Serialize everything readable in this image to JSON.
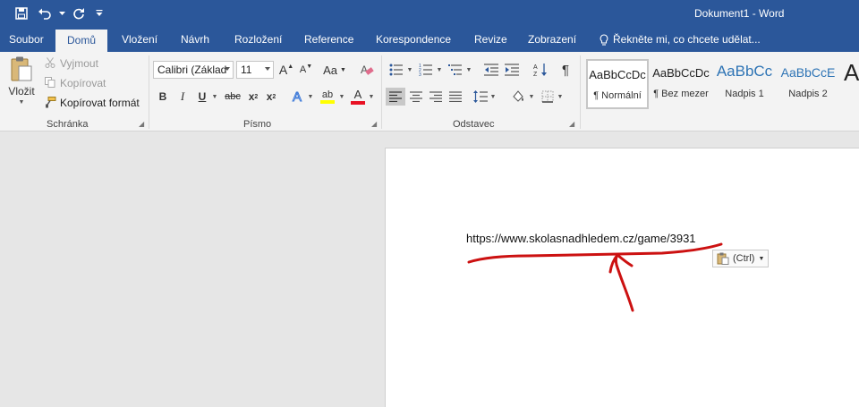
{
  "window": {
    "title": "Dokument1 - Word"
  },
  "quick_access": {
    "save_icon": "save-icon",
    "undo_icon": "undo-icon",
    "redo_icon": "redo-icon",
    "customize_icon": "customize-qat-icon"
  },
  "tabs": [
    {
      "label": "Soubor"
    },
    {
      "label": "Domů",
      "active": true
    },
    {
      "label": "Vložení"
    },
    {
      "label": "Návrh"
    },
    {
      "label": "Rozložení"
    },
    {
      "label": "Reference"
    },
    {
      "label": "Korespondence"
    },
    {
      "label": "Revize"
    },
    {
      "label": "Zobrazení"
    }
  ],
  "tell_me": {
    "placeholder": "Řekněte mi, co chcete udělat..."
  },
  "clipboard": {
    "group_label": "Schránka",
    "paste_label": "Vložit",
    "cut_label": "Vyjmout",
    "copy_label": "Kopírovat",
    "format_painter_label": "Kopírovat formát"
  },
  "font": {
    "group_label": "Písmo",
    "font_name": "Calibri (Základ",
    "font_size": "11",
    "bold": "B",
    "italic": "I",
    "underline": "U",
    "strikethrough": "abc",
    "subscript": "x",
    "superscript": "x",
    "subscript_mark": "2",
    "superscript_mark": "2",
    "grow": "A",
    "shrink": "A",
    "change_case": "Aa",
    "highlight": "ab",
    "font_color": "A",
    "effects": "A",
    "highlight_color": "#ffff00",
    "font_color_swatch": "#e81123"
  },
  "paragraph": {
    "group_label": "Odstavec",
    "show_marks": "¶"
  },
  "styles": {
    "items": [
      {
        "preview": "AaBbCcDc",
        "name": "¶ Normální",
        "selected": true
      },
      {
        "preview": "AaBbCcDc",
        "name": "¶ Bez mezer"
      },
      {
        "preview": "AaBbCc",
        "name": "Nadpis 1"
      },
      {
        "preview": "AaBbCcE",
        "name": "Nadpis 2"
      },
      {
        "preview": "A",
        "name": ""
      }
    ],
    "heading_color": "#2e74b5"
  },
  "document": {
    "text": "https://www.skolasnadhledem.cz/game/3931",
    "paste_options_label": "(Ctrl)",
    "annotation_color": "#cc1111"
  }
}
